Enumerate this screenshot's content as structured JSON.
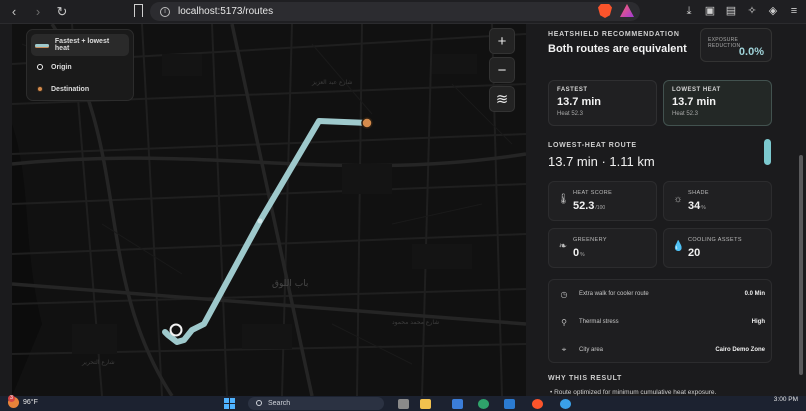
{
  "browser": {
    "url": "localhost:5173/routes",
    "nav_icons": [
      "back-icon",
      "forward-icon",
      "reload-icon",
      "bookmark-icon"
    ],
    "extension_icons": [
      "brave-shield-icon",
      "brave-rewards-icon"
    ],
    "tool_icons": [
      "download-icon",
      "sidebar-icon",
      "wallet-icon",
      "leo-icon",
      "vpn-icon",
      "menu-icon"
    ]
  },
  "map": {
    "legend": {
      "route": "Fastest + lowest heat",
      "origin": "Origin",
      "destination": "Destination"
    },
    "controls": [
      "zoom-in-icon",
      "zoom-out-icon",
      "layers-icon"
    ],
    "controls_glyphs": {
      "zoom_in": "+",
      "zoom_out": "−",
      "layers": "≋"
    },
    "route_color": "#9ec9cc",
    "destination_color": "#d58b4c",
    "street_labels": [
      "شارع عبد العزيز",
      "باب اللوق",
      "شارع التحرير",
      "شارع محمد محمود"
    ]
  },
  "panel": {
    "recommendation_label": "HEATSHIELD RECOMMENDATION",
    "recommendation_title": "Both routes are equivalent",
    "exposure_label": "EXPOSURE REDUCTION",
    "exposure_value": "0.0%",
    "fastest": {
      "title": "FASTEST",
      "minutes": "13.7 min",
      "heat": "Heat 52.3"
    },
    "lowest": {
      "title": "LOWEST HEAT",
      "minutes": "13.7 min",
      "heat": "Heat 52.3"
    },
    "lowest_heat_label": "LOWEST-HEAT ROUTE",
    "lowest_heat_summary": "13.7 min · 1.11 km",
    "metrics": {
      "heat_score": {
        "label": "HEAT SCORE",
        "value": "52.3",
        "unit": "/100",
        "icon": "thermometer-icon",
        "glyph": "🌡"
      },
      "shade": {
        "label": "SHADE",
        "value": "34",
        "unit": "%",
        "icon": "sun-icon",
        "glyph": "☼"
      },
      "greenery": {
        "label": "GREENERY",
        "value": "0",
        "unit": "%",
        "icon": "leaf-icon",
        "glyph": "❧"
      },
      "cooling": {
        "label": "COOLING ASSETS",
        "value": "20",
        "unit": "",
        "icon": "droplet-icon",
        "glyph": "💧"
      }
    },
    "info": [
      {
        "label": "Extra walk for cooler route",
        "value": "0.0 Min",
        "icon": "clock-icon",
        "glyph": "◷"
      },
      {
        "label": "Thermal stress",
        "value": "High",
        "icon": "footsteps-icon",
        "glyph": "⚲"
      },
      {
        "label": "City area",
        "value": "Cairo Demo Zone",
        "icon": "pin-icon",
        "glyph": "⌖"
      }
    ],
    "why_label": "WHY THIS RESULT",
    "why_text": "• Route optimized for minimum cumulative heat exposure."
  },
  "taskbar": {
    "badge": "3",
    "temperature": "96°F",
    "search_placeholder": "Search",
    "time": "3:00 PM"
  }
}
